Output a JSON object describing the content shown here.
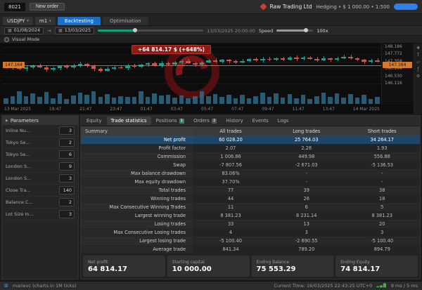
{
  "toolbar": {
    "logo": "8021",
    "new_order": "New order",
    "broker": "Raw Trading Ltd",
    "account_info": "Hedging • $ 1 000.00 • 1:500"
  },
  "tabbar": {
    "symbol": "USDJPY",
    "timeframe": "m1",
    "backtesting": "Backtesting",
    "optimisation": "Optimisation"
  },
  "controls": {
    "date_from": "01/08/2024",
    "date_to": "13/03/2025",
    "progress_pct": 35,
    "current_ts": "13/03/2025 20:00:00",
    "speed_label": "Speed",
    "speed_pct": 80,
    "speed_value": "100x"
  },
  "visual": {
    "label": "Visual Mode"
  },
  "chart": {
    "tooltip": "+64 814.17 $ (+648%)",
    "line_price": "147.164",
    "left_badge": "147.164",
    "price_min": 146.0,
    "price_max": 148.3,
    "price_labels": [
      "148.186",
      "147.772",
      "147.358",
      "146.944",
      "146.530",
      "146.116"
    ],
    "time_labels": [
      "13 Mar 2025",
      "19:47",
      "21:47",
      "23:47",
      "01:47",
      "03:47",
      "05:47",
      "07:47",
      "09:47",
      "11:47",
      "13:47",
      "14 Mar 2025"
    ],
    "tools": [
      {
        "name": "crosshair-icon",
        "glyph": "✚"
      },
      {
        "name": "text-tool-icon",
        "glyph": "T"
      },
      {
        "name": "shapes-tool-icon",
        "glyph": "▱"
      },
      {
        "name": "indicators-icon",
        "glyph": "ƒ"
      },
      {
        "name": "settings-icon",
        "glyph": "⚙"
      }
    ],
    "candles": [
      [
        147.1,
        147.0
      ],
      [
        147.0,
        147.08
      ],
      [
        147.08,
        146.95
      ],
      [
        146.95,
        147.05
      ],
      [
        147.05,
        147.15
      ],
      [
        147.15,
        147.05
      ],
      [
        147.05,
        146.9
      ],
      [
        146.9,
        146.98
      ],
      [
        146.98,
        147.1
      ],
      [
        147.1,
        147.02
      ],
      [
        147.02,
        147.12
      ],
      [
        147.12,
        147.22
      ],
      [
        147.22,
        147.1
      ],
      [
        147.1,
        146.95
      ],
      [
        146.95,
        146.85
      ],
      [
        146.85,
        146.95
      ],
      [
        146.95,
        147.05
      ],
      [
        147.05,
        147.0
      ],
      [
        147.0,
        147.12
      ],
      [
        147.12,
        147.06
      ],
      [
        147.06,
        147.18
      ],
      [
        147.18,
        147.25
      ],
      [
        147.25,
        147.15
      ],
      [
        147.15,
        147.28
      ],
      [
        147.28,
        147.2
      ],
      [
        147.2,
        147.3
      ],
      [
        147.3,
        147.38
      ],
      [
        147.38,
        147.28
      ],
      [
        147.28,
        147.2
      ],
      [
        147.2,
        147.32
      ],
      [
        147.32,
        147.42
      ],
      [
        147.42,
        147.35
      ],
      [
        147.35,
        147.45
      ],
      [
        147.45,
        147.38
      ],
      [
        147.38,
        147.3
      ],
      [
        147.3,
        147.4
      ],
      [
        147.4,
        147.5
      ],
      [
        147.5,
        147.42
      ],
      [
        147.42,
        147.52
      ],
      [
        147.52,
        147.45
      ],
      [
        147.45,
        147.55
      ],
      [
        147.55,
        147.48
      ],
      [
        147.48,
        147.58
      ],
      [
        147.58,
        147.5
      ],
      [
        147.5,
        147.6
      ],
      [
        147.6,
        147.52
      ],
      [
        147.52,
        147.44
      ],
      [
        147.44,
        147.54
      ],
      [
        147.54,
        147.46
      ],
      [
        147.46,
        147.56
      ],
      [
        147.56,
        147.64
      ],
      [
        147.64,
        147.55
      ],
      [
        147.55,
        147.45
      ],
      [
        147.45,
        147.35
      ],
      [
        147.35,
        147.42
      ],
      [
        147.42,
        147.36
      ]
    ]
  },
  "params": {
    "title": "Parameters",
    "rows": [
      {
        "label": "Inline Nu...",
        "value": "3"
      },
      {
        "label": "Tokyo Se...",
        "value": "2"
      },
      {
        "label": "Tokyo Se...",
        "value": "6"
      },
      {
        "label": "London S...",
        "value": "9"
      },
      {
        "label": "London S...",
        "value": "3"
      },
      {
        "label": "Close Tra...",
        "value": "140"
      },
      {
        "label": "Balance C...",
        "value": "2"
      },
      {
        "label": "Lot Size In...",
        "value": "3"
      }
    ]
  },
  "stats": {
    "tabs": [
      {
        "label": "Equity"
      },
      {
        "label": "Trade statistics",
        "active": true
      },
      {
        "label": "Positions",
        "badge": "1",
        "badge_color": "green"
      },
      {
        "label": "Orders",
        "badge": "2",
        "badge_color": "gray"
      },
      {
        "label": "History"
      },
      {
        "label": "Events"
      },
      {
        "label": "Logs"
      }
    ],
    "columns": [
      "Summary",
      "All trades",
      "Long trades",
      "Short trades"
    ],
    "highlight_row": 0,
    "rows": [
      [
        "Net profit",
        "60 028.20",
        "25 764.03",
        "34 264.17"
      ],
      [
        "Profit factor",
        "2.07",
        "2.28",
        "1.93"
      ],
      [
        "Commission",
        "1 006.86",
        "449.98",
        "556.88"
      ],
      [
        "Swap",
        "-7 807.56",
        "-2 671.03",
        "-5 136.53"
      ],
      [
        "Max balance drawdown",
        "83.06%",
        "-",
        "-"
      ],
      [
        "Max equity drawdown",
        "37.70%",
        "-",
        "-"
      ],
      [
        "Total trades",
        "77",
        "39",
        "38"
      ],
      [
        "Winning trades",
        "44",
        "26",
        "18"
      ],
      [
        "Max Consecutive Winning Trades",
        "11",
        "6",
        "5"
      ],
      [
        "Largest winning trade",
        "8 381.23",
        "8 231.14",
        "8 381.23"
      ],
      [
        "Losing trades",
        "33",
        "13",
        "20"
      ],
      [
        "Max Consecutive Losing trades",
        "4",
        "3",
        "3"
      ],
      [
        "Largest losing trade",
        "-5 100.40",
        "-2 690.55",
        "-5 100.40"
      ],
      [
        "Average trade",
        "841.34",
        "789.20",
        "894.79"
      ]
    ]
  },
  "summary_cards": [
    {
      "label": "Net profit",
      "value": "64 814.17"
    },
    {
      "label": "Starting capital",
      "value": "10 000.00"
    },
    {
      "label": "Ending Balance",
      "value": "75 553.29"
    },
    {
      "label": "Ending Equity",
      "value": "74 814.17"
    }
  ],
  "statusbar": {
    "left": "marievc (charts in 1M ticks)",
    "right_time": "Current Time: 16/03/2025 22:43:25 UTC+0",
    "latency": "8 ms / 5 ms"
  },
  "colors": {
    "accent_blue": "#1a6fc4",
    "candle_up": "#1f9d8a",
    "candle_down": "#c9554d",
    "highlight_orange": "#d97a2b",
    "tooltip_red": "#8f1b15",
    "progress_green": "#12a07a"
  }
}
